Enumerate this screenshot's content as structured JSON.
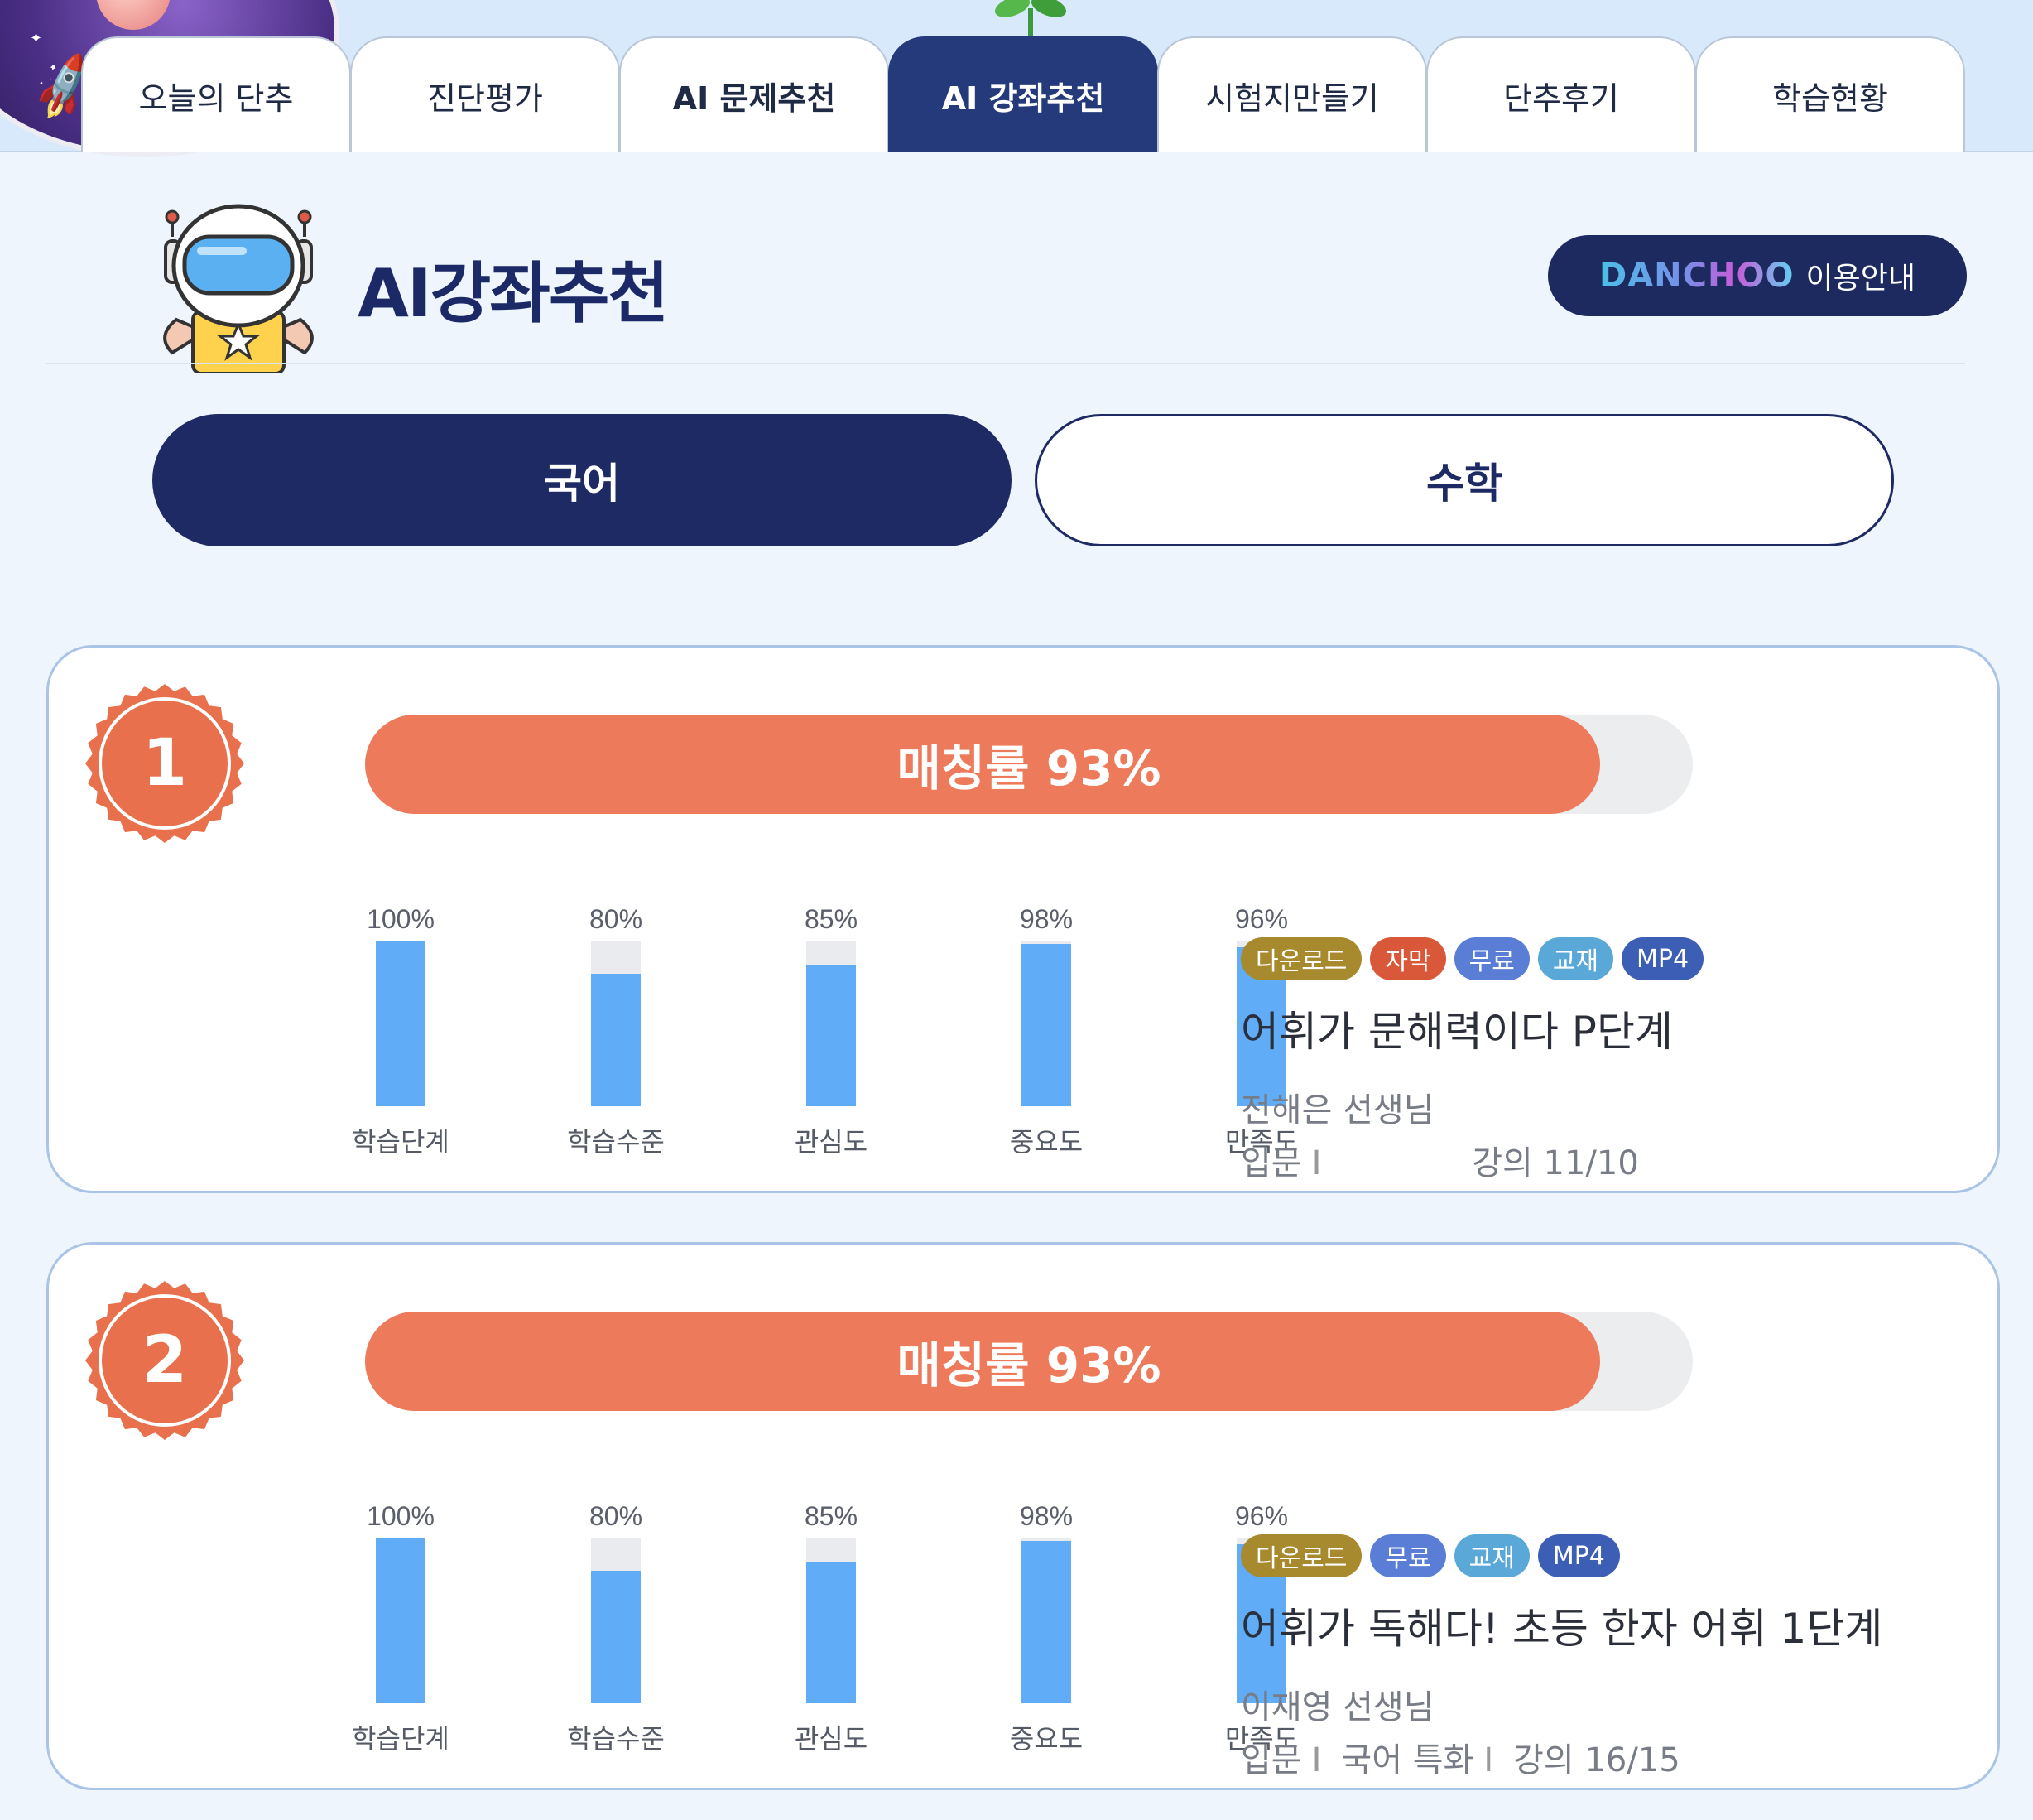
{
  "tabs": [
    {
      "label": "오늘의 단추",
      "active": false
    },
    {
      "label": "진단평가",
      "active": false
    },
    {
      "label": "AI 문제추천",
      "active": false
    },
    {
      "label": "AI 강좌추천",
      "active": true
    },
    {
      "label": "시험지만들기",
      "active": false
    },
    {
      "label": "단추후기",
      "active": false
    },
    {
      "label": "학습현황",
      "active": false
    }
  ],
  "header": {
    "title": "AI강좌추천",
    "guide_logo": "DANCHOO",
    "guide_label": "이용안내"
  },
  "subjects": [
    {
      "label": "국어",
      "selected": true
    },
    {
      "label": "수학",
      "selected": false
    }
  ],
  "cards": [
    {
      "rank": "1",
      "match_label": "매칭률 93%",
      "match_rate": 93,
      "metrics": [
        {
          "label": "학습단계",
          "value": "100%",
          "pct": 100
        },
        {
          "label": "학습수준",
          "value": "80%",
          "pct": 80
        },
        {
          "label": "관심도",
          "value": "85%",
          "pct": 85
        },
        {
          "label": "중요도",
          "value": "98%",
          "pct": 98
        },
        {
          "label": "만족도",
          "value": "96%",
          "pct": 96
        }
      ],
      "tags": [
        {
          "label": "다운로드",
          "color": "#a88a2e"
        },
        {
          "label": "자막",
          "color": "#d9583a"
        },
        {
          "label": "무료",
          "color": "#5a7ed6"
        },
        {
          "label": "교재",
          "color": "#5aa8d8"
        },
        {
          "label": "MP4",
          "color": "#3c5fb5"
        }
      ],
      "title": "어휘가 문해력이다 P단계",
      "teacher": "전해은 선생님",
      "level": "입문",
      "category": "",
      "lectures": "강의 11/10"
    },
    {
      "rank": "2",
      "match_label": "매칭률 93%",
      "match_rate": 93,
      "metrics": [
        {
          "label": "학습단계",
          "value": "100%",
          "pct": 100
        },
        {
          "label": "학습수준",
          "value": "80%",
          "pct": 80
        },
        {
          "label": "관심도",
          "value": "85%",
          "pct": 85
        },
        {
          "label": "중요도",
          "value": "98%",
          "pct": 98
        },
        {
          "label": "만족도",
          "value": "96%",
          "pct": 96
        }
      ],
      "tags": [
        {
          "label": "다운로드",
          "color": "#a88a2e"
        },
        {
          "label": "무료",
          "color": "#5a7ed6"
        },
        {
          "label": "교재",
          "color": "#5aa8d8"
        },
        {
          "label": "MP4",
          "color": "#3c5fb5"
        }
      ],
      "title": "어휘가 독해다! 초등 한자 어휘 1단계",
      "teacher": "이재영 선생님",
      "level": "입문",
      "category": "국어 특화",
      "lectures": "강의 16/15"
    }
  ],
  "colors": {
    "navy": "#1d2a63",
    "match_orange": "#ed7b5b",
    "metric_blue": "#60acf6",
    "badge_orange": "#e8704c"
  }
}
